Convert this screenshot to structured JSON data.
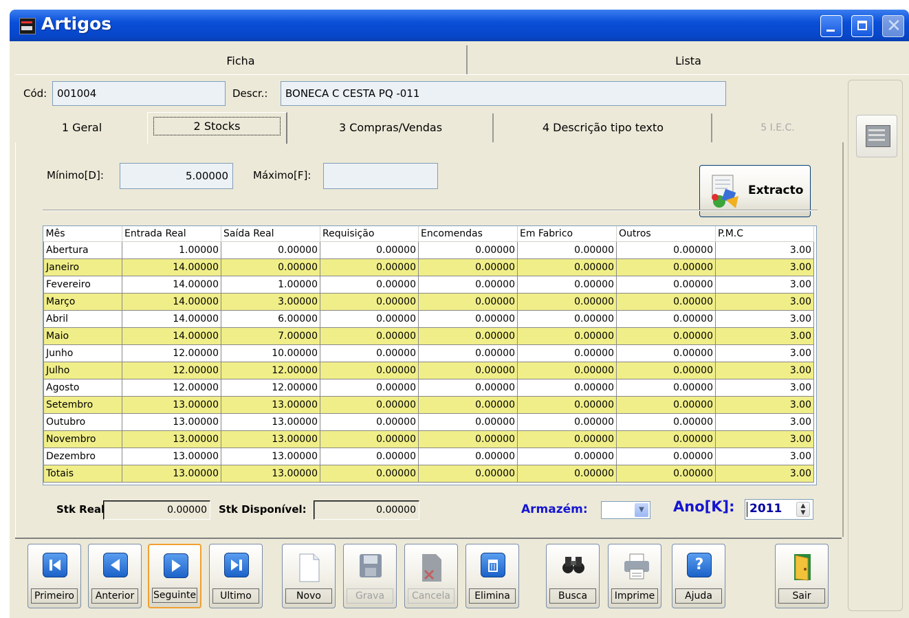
{
  "window": {
    "title": "Artigos"
  },
  "top_tabs": {
    "ficha": "Ficha",
    "lista": "Lista"
  },
  "header": {
    "cod_label": "Cód:",
    "cod_value": "001004",
    "descr_label": "Descr.:",
    "descr_value": "BONECA C CESTA PQ -011"
  },
  "tabs": {
    "geral": "1 Geral",
    "stocks": "2 Stocks",
    "compras": "3 Compras/Vendas",
    "descricao": "4 Descrição tipo texto",
    "iec": "5 I.E.C."
  },
  "limits": {
    "minimo_label": "Mínimo[D]:",
    "minimo_value": "5.00000",
    "maximo_label": "Máximo[F]:",
    "maximo_value": ""
  },
  "extracto_label": "Extracto",
  "grid": {
    "columns": [
      "Mês",
      "Entrada Real",
      "Saída Real",
      "Requisição",
      "Encomendas",
      "Em Fabrico",
      "Outros",
      "P.M.C"
    ],
    "rows": [
      [
        "Abertura",
        "1.00000",
        "0.00000",
        "0.00000",
        "0.00000",
        "0.00000",
        "0.00000",
        "3.00"
      ],
      [
        "Janeiro",
        "14.00000",
        "0.00000",
        "0.00000",
        "0.00000",
        "0.00000",
        "0.00000",
        "3.00"
      ],
      [
        "Fevereiro",
        "14.00000",
        "1.00000",
        "0.00000",
        "0.00000",
        "0.00000",
        "0.00000",
        "3.00"
      ],
      [
        "Março",
        "14.00000",
        "3.00000",
        "0.00000",
        "0.00000",
        "0.00000",
        "0.00000",
        "3.00"
      ],
      [
        "Abril",
        "14.00000",
        "6.00000",
        "0.00000",
        "0.00000",
        "0.00000",
        "0.00000",
        "3.00"
      ],
      [
        "Maio",
        "14.00000",
        "7.00000",
        "0.00000",
        "0.00000",
        "0.00000",
        "0.00000",
        "3.00"
      ],
      [
        "Junho",
        "12.00000",
        "10.00000",
        "0.00000",
        "0.00000",
        "0.00000",
        "0.00000",
        "3.00"
      ],
      [
        "Julho",
        "12.00000",
        "12.00000",
        "0.00000",
        "0.00000",
        "0.00000",
        "0.00000",
        "3.00"
      ],
      [
        "Agosto",
        "12.00000",
        "12.00000",
        "0.00000",
        "0.00000",
        "0.00000",
        "0.00000",
        "3.00"
      ],
      [
        "Setembro",
        "13.00000",
        "13.00000",
        "0.00000",
        "0.00000",
        "0.00000",
        "0.00000",
        "3.00"
      ],
      [
        "Outubro",
        "13.00000",
        "13.00000",
        "0.00000",
        "0.00000",
        "0.00000",
        "0.00000",
        "3.00"
      ],
      [
        "Novembro",
        "13.00000",
        "13.00000",
        "0.00000",
        "0.00000",
        "0.00000",
        "0.00000",
        "3.00"
      ],
      [
        "Dezembro",
        "13.00000",
        "13.00000",
        "0.00000",
        "0.00000",
        "0.00000",
        "0.00000",
        "3.00"
      ],
      [
        "Totais",
        "13.00000",
        "13.00000",
        "0.00000",
        "0.00000",
        "0.00000",
        "0.00000",
        "3.00"
      ]
    ]
  },
  "footer": {
    "stk_real_label": "Stk Real:",
    "stk_real_value": "0.00000",
    "stk_disp_label": "Stk Disponível:",
    "stk_disp_value": "0.00000",
    "armazem_label": "Armazém:",
    "armazem_value": "",
    "ano_label": "Ano[K]:",
    "ano_value": "2011"
  },
  "toolbar": {
    "primeiro": "Primeiro",
    "anterior": "Anterior",
    "seguinte": "Seguinte",
    "ultimo": "Ultimo",
    "novo": "Novo",
    "grava": "Grava",
    "cancela": "Cancela",
    "elimina": "Elimina",
    "busca": "Busca",
    "imprime": "Imprime",
    "ajuda": "Ajuda",
    "sair": "Sair"
  },
  "colors": {
    "title_bar": "#0a4fd8",
    "row_highlight": "#f0ee88",
    "accent_text": "#1515d0",
    "selected_button_border": "#f0a030"
  }
}
